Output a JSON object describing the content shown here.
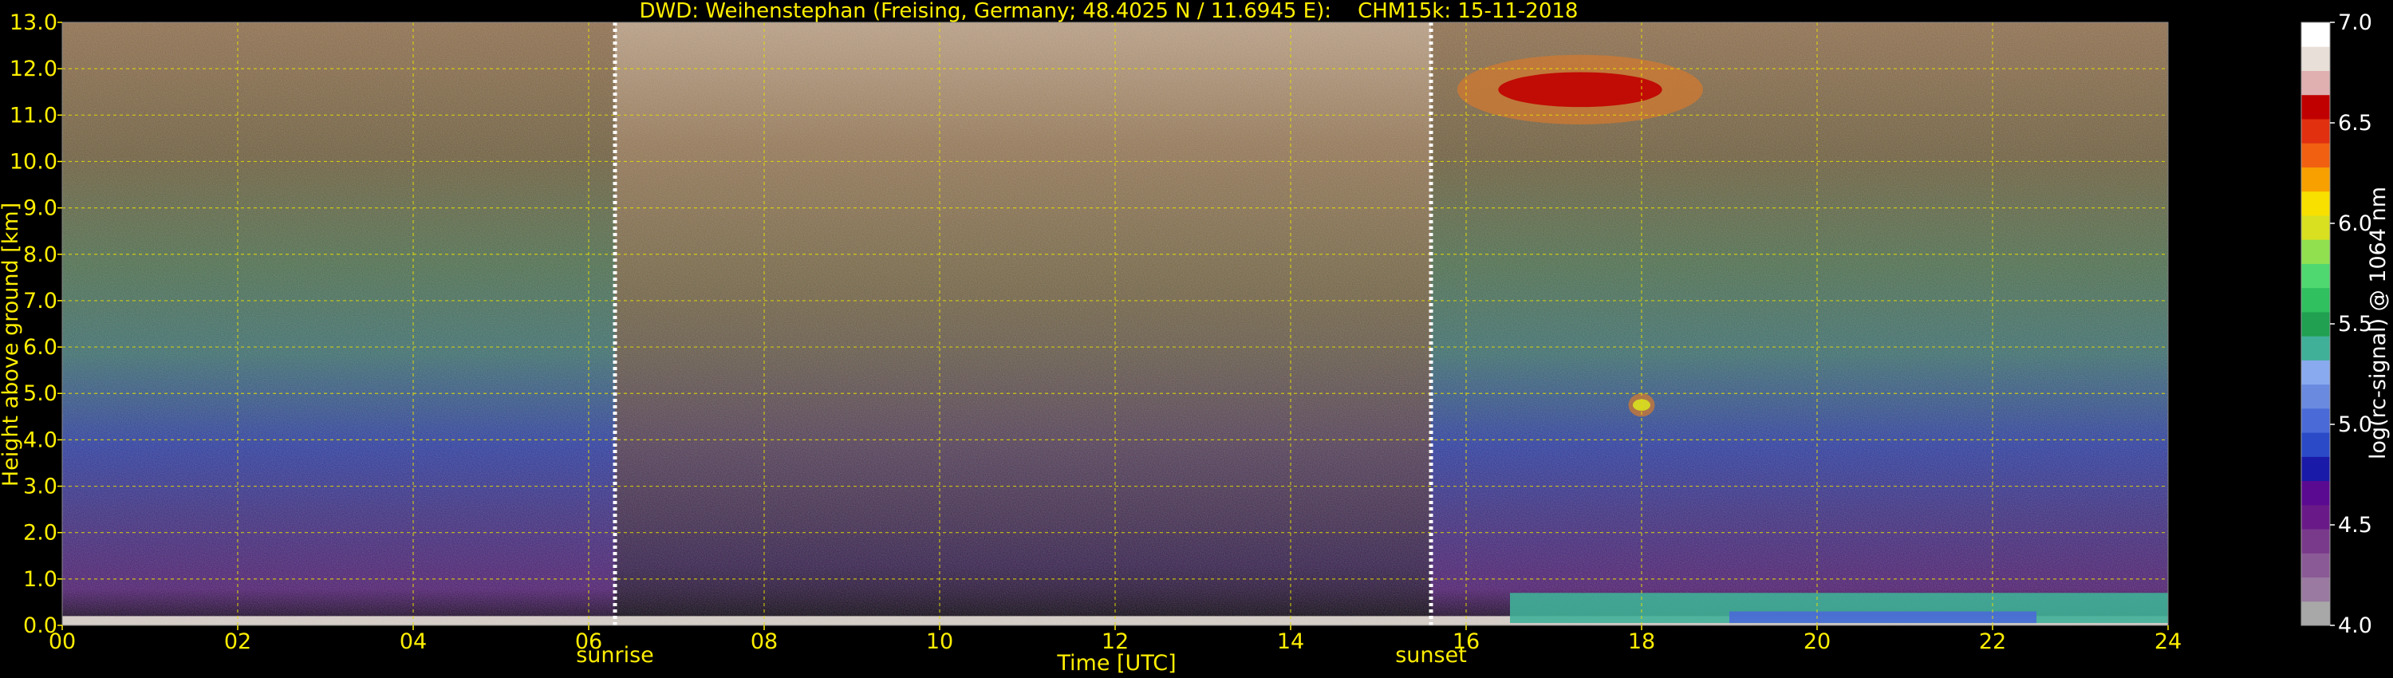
{
  "chart_data": {
    "type": "heatmap",
    "title": "DWD: Weihenstephan (Freising, Germany; 48.4025 N / 11.6945 E):    CHM15k: 15-11-2018",
    "xlabel": "Time [UTC]",
    "ylabel": "Height above ground [km]",
    "colorbar_label": "log(rc-signal) @ 1064 nm",
    "xlim": [
      0,
      24
    ],
    "ylim": [
      0,
      13
    ],
    "clim": [
      4.0,
      7.0
    ],
    "x_ticks": [
      0,
      2,
      4,
      6,
      8,
      10,
      12,
      14,
      16,
      18,
      20,
      22,
      24
    ],
    "x_tick_labels": [
      "00",
      "02",
      "04",
      "06",
      "08",
      "10",
      "12",
      "14",
      "16",
      "18",
      "20",
      "22",
      "24"
    ],
    "y_ticks": [
      0,
      1,
      2,
      3,
      4,
      5,
      6,
      7,
      8,
      9,
      10,
      11,
      12,
      13
    ],
    "y_tick_labels": [
      "0.0",
      "1.0",
      "2.0",
      "3.0",
      "4.0",
      "5.0",
      "6.0",
      "7.0",
      "8.0",
      "9.0",
      "10.0",
      "11.0",
      "12.0",
      "13.0"
    ],
    "cbar_ticks": [
      4.0,
      4.5,
      5.0,
      5.5,
      6.0,
      6.5,
      7.0
    ],
    "cbar_tick_labels": [
      "4.0",
      "4.5",
      "5.0",
      "5.5",
      "6.0",
      "6.5",
      "7.0"
    ],
    "grid": true,
    "colormap": [
      "#a8a8a8",
      "#9a7aa0",
      "#8a5a96",
      "#7a3a8c",
      "#6a1a88",
      "#5a0a90",
      "#1a1aa8",
      "#2a4ac8",
      "#4a6ad8",
      "#6a8ae0",
      "#8aaaf0",
      "#40b098",
      "#20a050",
      "#30c060",
      "#50d870",
      "#90e050",
      "#d8e020",
      "#f8e000",
      "#f8a000",
      "#f06010",
      "#e03010",
      "#c00000",
      "#e0b0b0",
      "#e8e0d8",
      "#ffffff"
    ],
    "markers": [
      {
        "x": 6.3,
        "label": "sunrise"
      },
      {
        "x": 15.6,
        "label": "sunset"
      }
    ],
    "features": [
      {
        "name": "surface-layer",
        "x": [
          0,
          24
        ],
        "y": [
          0,
          0.2
        ],
        "value": 6.8
      },
      {
        "name": "aerosol-layer-afternoon",
        "x": [
          16.5,
          24
        ],
        "y": [
          0.05,
          0.7
        ],
        "value": 5.4
      },
      {
        "name": "aerosol-layer-blue",
        "x": [
          19.0,
          22.5
        ],
        "y": [
          0.05,
          0.3
        ],
        "value": 5.0
      },
      {
        "name": "cirrus-cloud",
        "x": [
          15.9,
          18.7
        ],
        "y": [
          10.8,
          12.3
        ],
        "value": 6.6
      },
      {
        "name": "isolated-cloud",
        "x": [
          17.85,
          18.15
        ],
        "y": [
          4.5,
          5.0
        ],
        "value": 6.0
      }
    ]
  }
}
